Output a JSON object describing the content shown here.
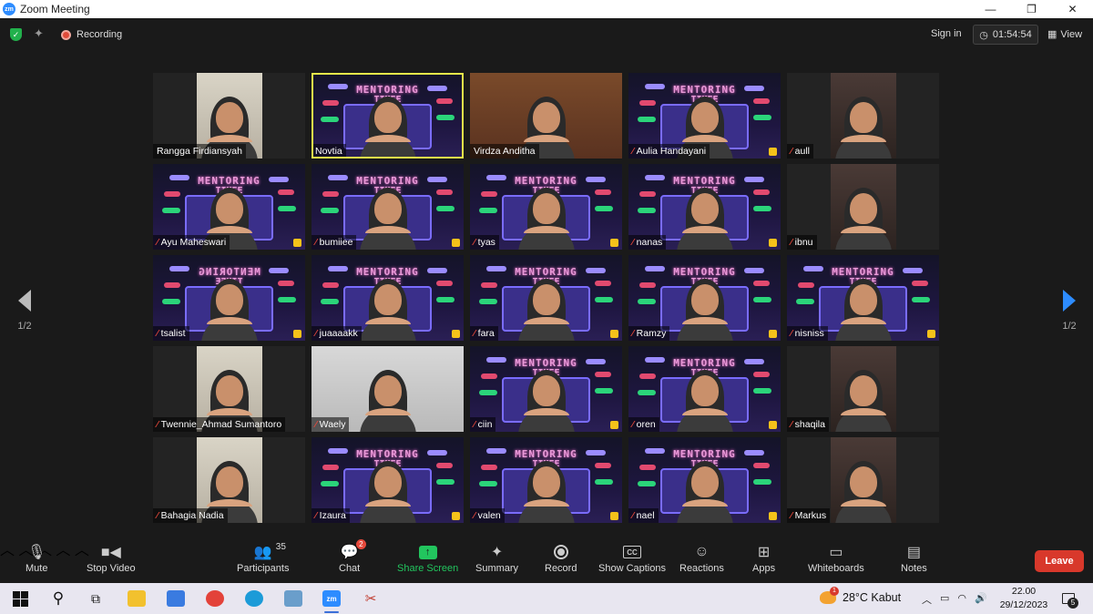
{
  "window": {
    "title": "Zoom Meeting",
    "logo": "zm",
    "minimize": "—",
    "restore": "❐",
    "close": "✕"
  },
  "topbar": {
    "recording_label": "Recording",
    "sign_in": "Sign in",
    "timer": "01:54:54",
    "view_label": "View"
  },
  "pager": {
    "left_label": "1/2",
    "right_label": "1/2"
  },
  "tiles": [
    {
      "name": "Rangga Firdiansyah",
      "kind": "photo",
      "muted": false
    },
    {
      "name": "Novtia",
      "kind": "poster",
      "active": true,
      "muted": false
    },
    {
      "name": "Virdza Anditha",
      "kind": "photo",
      "muted": false
    },
    {
      "name": "Aulia Handayani",
      "kind": "poster",
      "muted": true
    },
    {
      "name": "aull",
      "kind": "photo",
      "muted": true
    },
    {
      "name": "Ayu Maheswari",
      "kind": "poster",
      "muted": true
    },
    {
      "name": "bumiiee",
      "kind": "poster",
      "muted": true
    },
    {
      "name": "tyas",
      "kind": "poster",
      "muted": true
    },
    {
      "name": "nanas",
      "kind": "poster",
      "muted": true
    },
    {
      "name": "ibnu",
      "kind": "photo",
      "muted": true
    },
    {
      "name": "tsalist",
      "kind": "poster",
      "muted": true
    },
    {
      "name": "juaaaakk",
      "kind": "poster",
      "muted": true
    },
    {
      "name": "fara",
      "kind": "poster",
      "muted": true
    },
    {
      "name": "Ramzy",
      "kind": "poster",
      "muted": true
    },
    {
      "name": "nisniss",
      "kind": "poster",
      "muted": true
    },
    {
      "name": "Twennie_Ahmad Sumantoro",
      "kind": "photo",
      "muted": true
    },
    {
      "name": "Waely",
      "kind": "photo",
      "muted": true
    },
    {
      "name": "ciin",
      "kind": "poster",
      "muted": true
    },
    {
      "name": "oren",
      "kind": "poster",
      "muted": true
    },
    {
      "name": "shaqila",
      "kind": "photo",
      "muted": true
    },
    {
      "name": "Bahagia Nadia",
      "kind": "photo",
      "muted": true
    },
    {
      "name": "Izaura",
      "kind": "poster",
      "muted": true
    },
    {
      "name": "valen",
      "kind": "poster",
      "muted": true
    },
    {
      "name": "nael",
      "kind": "poster",
      "muted": true
    },
    {
      "name": "Markus",
      "kind": "photo",
      "muted": true
    }
  ],
  "poster_text": {
    "line1": "MENTORING",
    "line2": "TIMEE",
    "mirrored": "MENTORING"
  },
  "toolbar": {
    "mute": "Mute",
    "stop_video": "Stop Video",
    "participants": "Participants",
    "participants_count": "35",
    "chat": "Chat",
    "chat_badge": "2",
    "share_screen": "Share Screen",
    "summary": "Summary",
    "record": "Record",
    "show_captions": "Show Captions",
    "reactions": "Reactions",
    "apps": "Apps",
    "whiteboards": "Whiteboards",
    "notes": "Notes",
    "leave": "Leave",
    "cc": "CC"
  },
  "taskbar": {
    "weather": "28°C  Kabut",
    "time": "22.00",
    "date": "29/12/2023",
    "notification_count": "5"
  },
  "colors": {
    "accent": "#2d8cff",
    "share": "#22c55e",
    "leave": "#d8382b",
    "active_speaker": "#e5e94a",
    "muted_mic": "#e5483b"
  }
}
